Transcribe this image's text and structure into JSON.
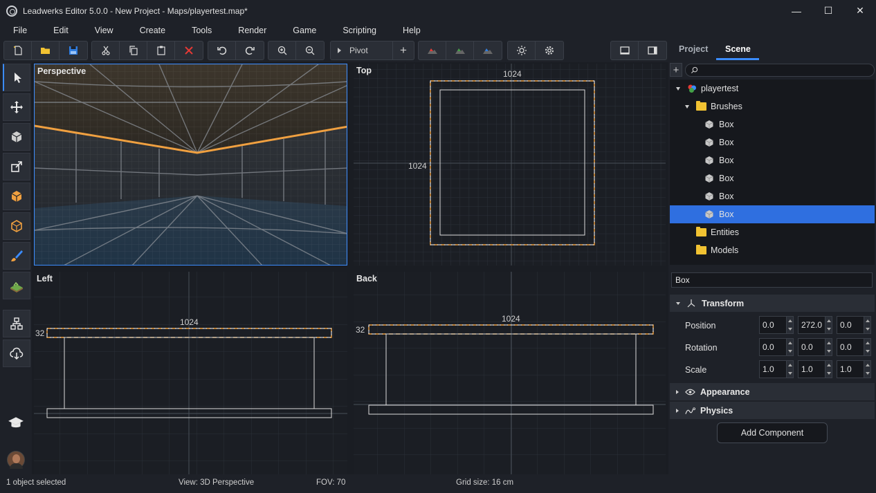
{
  "window": {
    "title": "Leadwerks Editor 5.0.0 - New Project - Maps/playertest.map*",
    "minimize_glyph": "—",
    "maximize_glyph": "☐",
    "close_glyph": "✕"
  },
  "menu": [
    "File",
    "Edit",
    "View",
    "Create",
    "Tools",
    "Render",
    "Game",
    "Scripting",
    "Help"
  ],
  "toolbar": {
    "pivot_label": "Pivot",
    "add_glyph": "+",
    "icons": [
      "new-file-icon",
      "open-folder-icon",
      "save-icon",
      "cut-icon",
      "copy-icon",
      "paste-icon",
      "delete-icon",
      "undo-icon",
      "redo-icon",
      "zoom-in-icon",
      "zoom-out-icon",
      "terrain-red-icon",
      "terrain-green-icon",
      "terrain-blue-icon",
      "sun-icon",
      "settings-gear-icon",
      "layout-single-icon",
      "layout-side-icon"
    ]
  },
  "left_tools": [
    "select-arrow-icon",
    "move-icon",
    "rotate-icon",
    "scale-icon",
    "brush-box-icon",
    "vertex-edit-icon",
    "paint-brush-icon",
    "terrain-icon",
    "hierarchy-icon",
    "cloud-publish-icon",
    "tutorial-hat-icon",
    "user-avatar"
  ],
  "viewports": {
    "perspective": {
      "label": "Perspective"
    },
    "top": {
      "label": "Top",
      "dim_top": "1024",
      "dim_side": "1024"
    },
    "left": {
      "label": "Left",
      "dim_top": "1024",
      "dim_side": "32"
    },
    "back": {
      "label": "Back",
      "dim_top": "1024",
      "dim_side": "32"
    }
  },
  "panel": {
    "tabs": [
      "Project",
      "Scene"
    ],
    "active_tab": "Scene",
    "add_glyph": "+",
    "tree": [
      {
        "label": "playertest",
        "type": "scene",
        "depth": 0,
        "expanded": true
      },
      {
        "label": "Brushes",
        "type": "folder",
        "depth": 1,
        "expanded": true
      },
      {
        "label": "Box",
        "type": "brush",
        "depth": 2
      },
      {
        "label": "Box",
        "type": "brush",
        "depth": 2
      },
      {
        "label": "Box",
        "type": "brush",
        "depth": 2
      },
      {
        "label": "Box",
        "type": "brush",
        "depth": 2
      },
      {
        "label": "Box",
        "type": "brush",
        "depth": 2
      },
      {
        "label": "Box",
        "type": "brush",
        "depth": 2,
        "selected": true
      },
      {
        "label": "Entities",
        "type": "folder",
        "depth": 1
      },
      {
        "label": "Models",
        "type": "folder",
        "depth": 1
      }
    ],
    "selected_name": "Box",
    "transform": {
      "title": "Transform",
      "position_label": "Position",
      "rotation_label": "Rotation",
      "scale_label": "Scale",
      "position": [
        "0.0",
        "272.0",
        "0.0"
      ],
      "rotation": [
        "0.0",
        "0.0",
        "0.0"
      ],
      "scale": [
        "1.0",
        "1.0",
        "1.0"
      ]
    },
    "appearance_title": "Appearance",
    "physics_title": "Physics",
    "add_component": "Add Component"
  },
  "status": {
    "selection": "1 object selected",
    "view": "View: 3D Perspective",
    "fov": "FOV: 70",
    "grid": "Grid size: 16 cm"
  },
  "colors": {
    "accent": "#3b8cff",
    "selection_orange": "#f0a040",
    "folder": "#f1c232",
    "delete_red": "#e53935"
  }
}
